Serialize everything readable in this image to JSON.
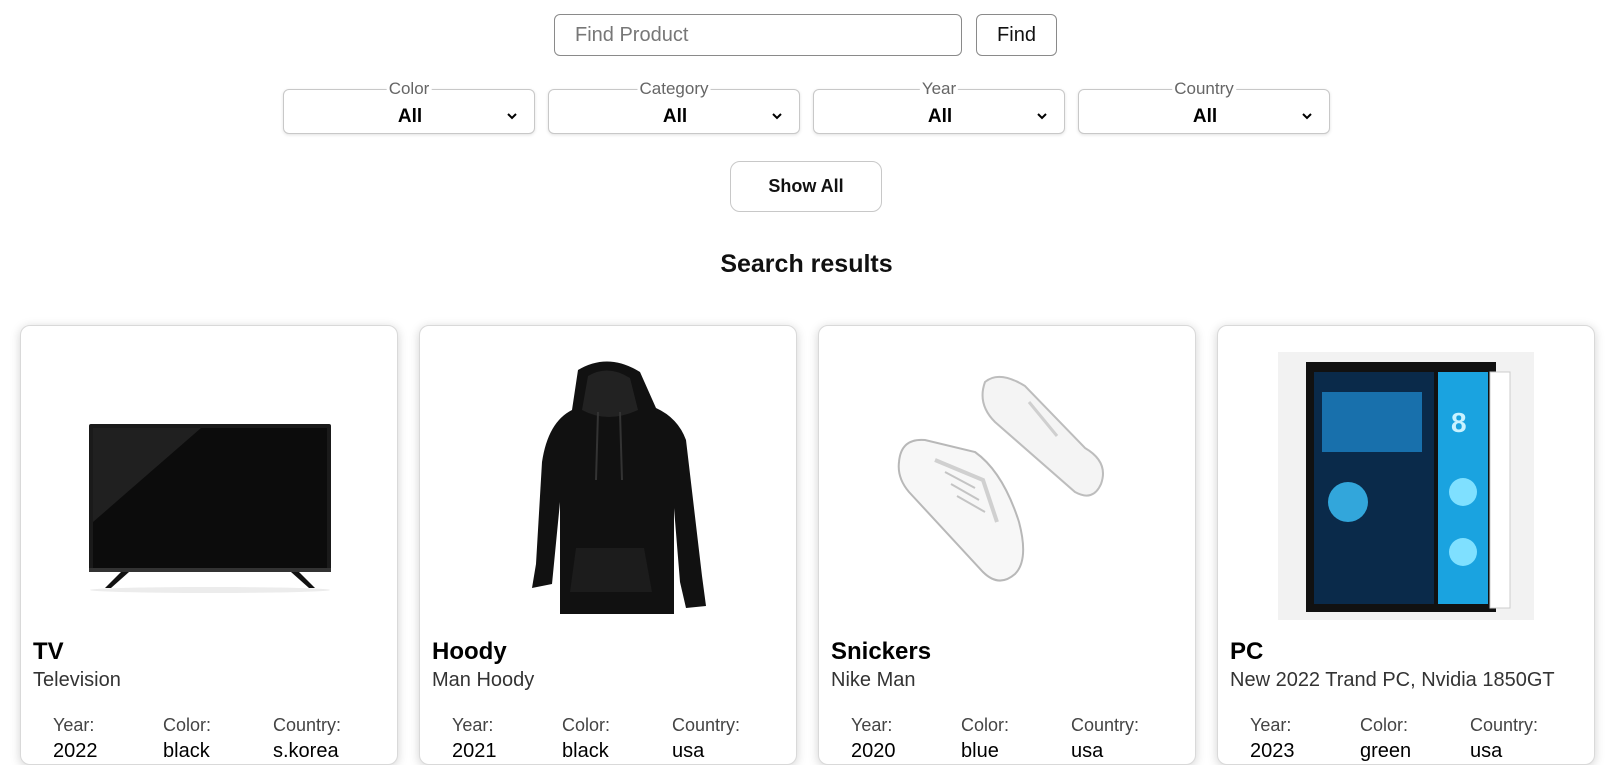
{
  "search": {
    "placeholder": "Find Product",
    "button_label": "Find"
  },
  "filters": [
    {
      "label": "Color",
      "value": "All"
    },
    {
      "label": "Category",
      "value": "All"
    },
    {
      "label": "Year",
      "value": "All"
    },
    {
      "label": "Country",
      "value": "All"
    }
  ],
  "show_all_label": "Show All",
  "results_title": "Search results",
  "meta_labels": {
    "year": "Year:",
    "color": "Color:",
    "country": "Country:"
  },
  "products": [
    {
      "name": "TV",
      "description": "Television",
      "year": "2022",
      "color": "black",
      "country": "s.korea",
      "icon": "tv-image"
    },
    {
      "name": "Hoody",
      "description": "Man Hoody",
      "year": "2021",
      "color": "black",
      "country": "usa",
      "icon": "hoody-image"
    },
    {
      "name": "Snickers",
      "description": "Nike Man",
      "year": "2020",
      "color": "blue",
      "country": "usa",
      "icon": "sneakers-image"
    },
    {
      "name": "PC",
      "description": "New 2022 Trand PC, Nvidia 1850GT",
      "year": "2023",
      "color": "green",
      "country": "usa",
      "icon": "pc-image"
    }
  ]
}
